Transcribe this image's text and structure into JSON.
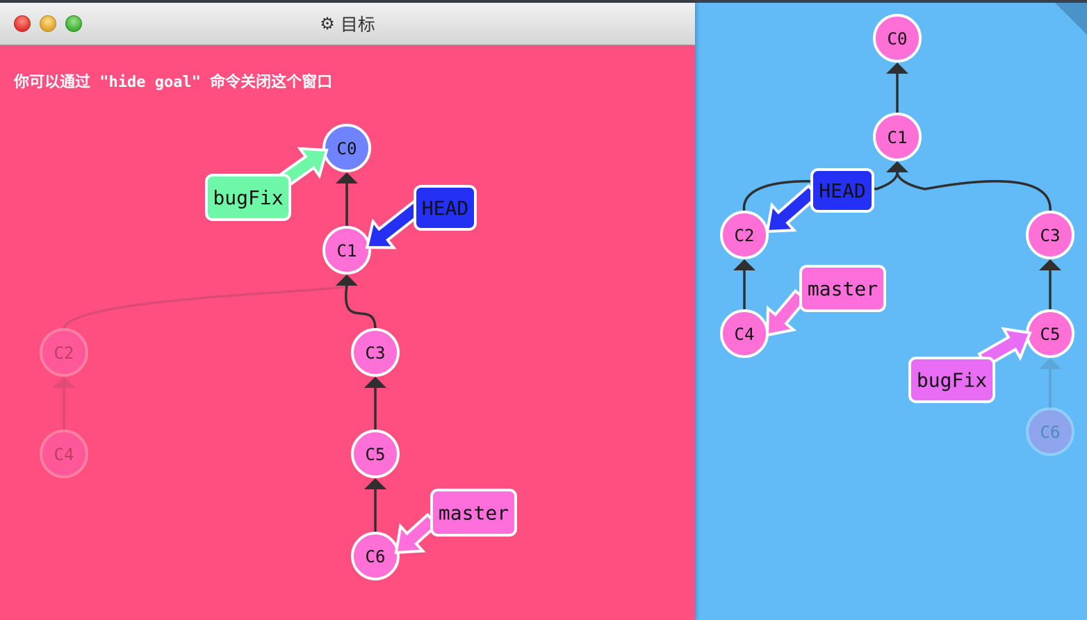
{
  "window": {
    "title": "目标",
    "title_icon": "gear-icon",
    "hint": "你可以通过 \"hide goal\" 命令关闭这个窗口"
  },
  "colors": {
    "goal_background": "#ff4f80",
    "main_background": "#62bbf7",
    "commit_fill": "#ff70d6",
    "commit_root_goal": "#6f83ff",
    "head_branch": "#2431f5",
    "bugfix_goal": "#6df7a7",
    "bugfix_main": "#e96cf5",
    "master_branch": "#ff6fdc"
  },
  "goal_tree": {
    "commits": [
      {
        "id": "C0",
        "label": "C0",
        "faded": false,
        "root": true
      },
      {
        "id": "C1",
        "label": "C1",
        "faded": false
      },
      {
        "id": "C2",
        "label": "C2",
        "faded": true
      },
      {
        "id": "C3",
        "label": "C3",
        "faded": false
      },
      {
        "id": "C4",
        "label": "C4",
        "faded": true
      },
      {
        "id": "C5",
        "label": "C5",
        "faded": false
      },
      {
        "id": "C6",
        "label": "C6",
        "faded": false
      }
    ],
    "edges": [
      {
        "from": "C1",
        "to": "C0",
        "faded": false
      },
      {
        "from": "C2",
        "to": "C1",
        "faded": true
      },
      {
        "from": "C3",
        "to": "C1",
        "faded": false
      },
      {
        "from": "C4",
        "to": "C2",
        "faded": true
      },
      {
        "from": "C5",
        "to": "C3",
        "faded": false
      },
      {
        "from": "C6",
        "to": "C5",
        "faded": false
      }
    ],
    "branches": [
      {
        "name": "bugFix",
        "target": "C0",
        "color": "#6df7a7"
      },
      {
        "name": "HEAD",
        "target": "C1",
        "color": "#2431f5"
      },
      {
        "name": "master",
        "target": "C6",
        "color": "#ff6fdc"
      }
    ]
  },
  "main_tree": {
    "commits": [
      {
        "id": "C0",
        "label": "C0",
        "faded": false
      },
      {
        "id": "C1",
        "label": "C1",
        "faded": false
      },
      {
        "id": "C2",
        "label": "C2",
        "faded": false
      },
      {
        "id": "C3",
        "label": "C3",
        "faded": false
      },
      {
        "id": "C4",
        "label": "C4",
        "faded": false
      },
      {
        "id": "C5",
        "label": "C5",
        "faded": false
      },
      {
        "id": "C6",
        "label": "C6",
        "faded": true
      }
    ],
    "edges": [
      {
        "from": "C1",
        "to": "C0",
        "faded": false
      },
      {
        "from": "C2",
        "to": "C1",
        "faded": false
      },
      {
        "from": "C3",
        "to": "C1",
        "faded": false
      },
      {
        "from": "C4",
        "to": "C2",
        "faded": false
      },
      {
        "from": "C5",
        "to": "C3",
        "faded": false
      },
      {
        "from": "C6",
        "to": "C5",
        "faded": true
      }
    ],
    "branches": [
      {
        "name": "HEAD",
        "target": "C2",
        "color": "#2431f5"
      },
      {
        "name": "master",
        "target": "C4",
        "color": "#ff6fdc"
      },
      {
        "name": "bugFix",
        "target": "C5",
        "color": "#e96cf5"
      }
    ]
  }
}
